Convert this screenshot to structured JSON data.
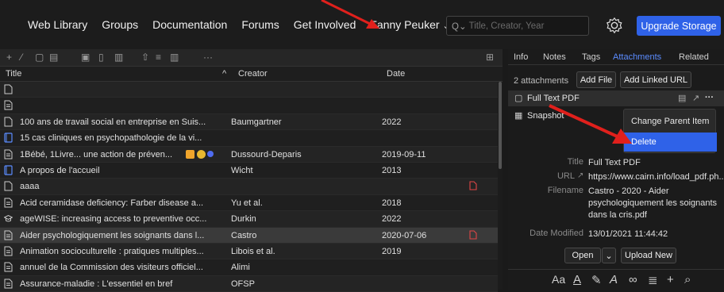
{
  "nav": {
    "web_library": "Web Library",
    "groups": "Groups",
    "documentation": "Documentation",
    "forums": "Forums",
    "get_involved": "Get Involved",
    "user": "Fanny Peuker",
    "user_chevron": "⌄"
  },
  "search": {
    "placeholder": "Title, Creator, Year"
  },
  "upgrade_label": "Upgrade Storage",
  "toolbar": {
    "more": "···"
  },
  "columns": {
    "title": "Title",
    "sort": "^",
    "creator": "Creator",
    "date": "Date"
  },
  "items": [
    {
      "title": "",
      "creator": "",
      "date": "",
      "icon": "doc",
      "pdf": false
    },
    {
      "title": "",
      "creator": "",
      "date": "",
      "icon": "doc-text",
      "pdf": false
    },
    {
      "title": "100 ans de travail social en entreprise en Suis...",
      "creator": "Baumgartner",
      "date": "2022",
      "icon": "doc",
      "pdf": false
    },
    {
      "title": "15 cas cliniques en psychopathologie de la vi...",
      "creator": "",
      "date": "",
      "icon": "book",
      "pdf": false
    },
    {
      "title": "1Bébé, 1Livre... une action de préven...",
      "creator": "Dussourd-Deparis",
      "date": "2019-09-11",
      "icon": "doc-text",
      "pdf": false
    },
    {
      "title": "A propos de l'accueil",
      "creator": "Wicht",
      "date": "2013",
      "icon": "book",
      "pdf": false
    },
    {
      "title": "aaaa",
      "creator": "",
      "date": "",
      "icon": "doc",
      "pdf": true
    },
    {
      "title": "Acid ceramidase deficiency: Farber disease a...",
      "creator": "Yu et al.",
      "date": "2018",
      "icon": "doc-text",
      "pdf": false
    },
    {
      "title": "ageWISE: increasing access to preventive occ...",
      "creator": "Durkin",
      "date": "2022",
      "icon": "cap",
      "pdf": false
    },
    {
      "title": "Aider psychologiquement les soignants dans l...",
      "creator": "Castro",
      "date": "2020-07-06",
      "icon": "doc-text",
      "pdf": true
    },
    {
      "title": "Animation socioculturelle : pratiques multiples...",
      "creator": "Libois et al.",
      "date": "2019",
      "icon": "doc-text",
      "pdf": false
    },
    {
      "title": "annuel de la Commission des visiteurs officiel...",
      "creator": "Alimi",
      "date": "",
      "icon": "doc-text",
      "pdf": false
    },
    {
      "title": "Assurance-maladie : L'essentiel en bref",
      "creator": "OFSP",
      "date": "",
      "icon": "doc-text",
      "pdf": false
    }
  ],
  "tabs": {
    "info": "Info",
    "notes": "Notes",
    "tags": "Tags",
    "attachments": "Attachments",
    "related": "Related"
  },
  "attachments": {
    "count": "2 attachments",
    "add_file": "Add File",
    "add_linked_url": "Add Linked URL",
    "item1": "Full Text PDF",
    "item2": "Snapshot",
    "more": "···"
  },
  "context_menu": {
    "change_parent": "Change Parent Item",
    "delete": "Delete"
  },
  "meta": {
    "title_label": "Title",
    "title_value": "Full Text PDF",
    "url_label": "URL",
    "url_value": "https://www.cairn.info/load_pdf.ph...",
    "filename_label": "Filename",
    "filename_value": "Castro - 2020 - Aider psychologiquement les soignants dans la cris.pdf",
    "modified_label": "Date Modified",
    "modified_value": "13/01/2021 11:44:42"
  },
  "actions": {
    "open": "Open",
    "open_chevron": "⌄",
    "upload_new": "Upload New"
  },
  "bottom_toolbar": {
    "aa": "Aa",
    "plus": "+"
  },
  "colors": {
    "accent": "#2f62e8",
    "annotation_arrow": "#e0201c"
  }
}
